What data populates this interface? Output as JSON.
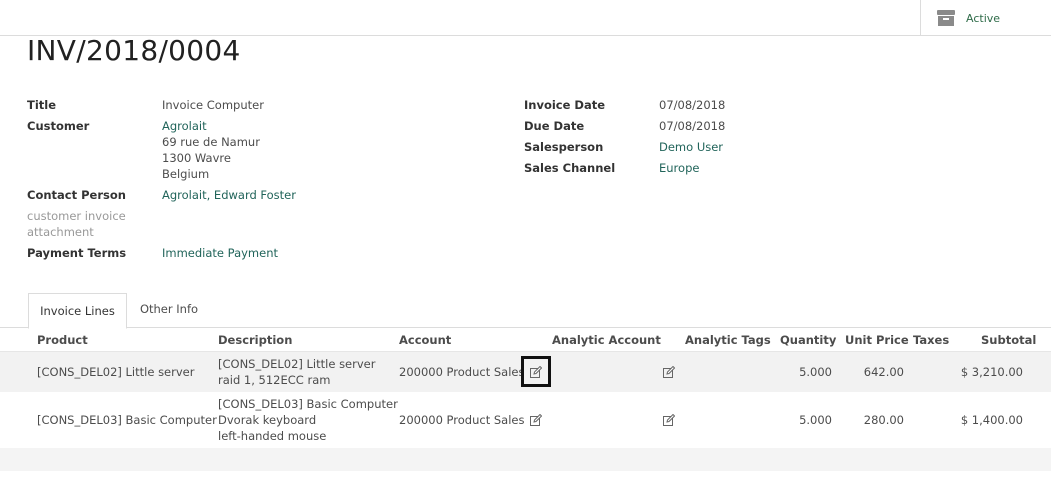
{
  "status": {
    "label": "Active",
    "icon": "archive-icon"
  },
  "title": "INV/2018/0004",
  "left_fields": {
    "title_label": "Title",
    "title_value": "Invoice Computer",
    "customer_label": "Customer",
    "customer_name": "Agrolait",
    "customer_address": [
      "69 rue de Namur",
      "1300 Wavre",
      "Belgium"
    ],
    "contact_label": "Contact Person",
    "contact_value": "Agrolait, Edward Foster",
    "attachment_label_1": "customer invoice",
    "attachment_label_2": "attachment",
    "payment_terms_label": "Payment Terms",
    "payment_terms_value": "Immediate Payment"
  },
  "right_fields": {
    "invoice_date_label": "Invoice Date",
    "invoice_date_value": "07/08/2018",
    "due_date_label": "Due Date",
    "due_date_value": "07/08/2018",
    "salesperson_label": "Salesperson",
    "salesperson_value": "Demo User",
    "sales_channel_label": "Sales Channel",
    "sales_channel_value": "Europe"
  },
  "tabs": {
    "invoice_lines": "Invoice Lines",
    "other_info": "Other Info"
  },
  "columns": {
    "product": "Product",
    "description": "Description",
    "account": "Account",
    "analytic_account": "Analytic Account",
    "analytic_tags": "Analytic Tags",
    "quantity": "Quantity",
    "unit_price": "Unit Price",
    "taxes": "Taxes",
    "subtotal": "Subtotal"
  },
  "lines": [
    {
      "product": "[CONS_DEL02] Little server",
      "description": [
        "[CONS_DEL02] Little server",
        "raid 1, 512ECC ram"
      ],
      "account": "200000 Product Sales",
      "quantity": "5.000",
      "unit_price": "642.00",
      "subtotal": "$ 3,210.00"
    },
    {
      "product": "[CONS_DEL03] Basic Computer",
      "description": [
        "[CONS_DEL03] Basic Computer",
        "Dvorak keyboard",
        "left-handed mouse"
      ],
      "account": "200000 Product Sales",
      "quantity": "5.000",
      "unit_price": "280.00",
      "subtotal": "$ 1,400.00"
    }
  ],
  "colors": {
    "link": "#21645a",
    "status": "#2e6b48",
    "row_stripe": "#f2f2f2"
  }
}
